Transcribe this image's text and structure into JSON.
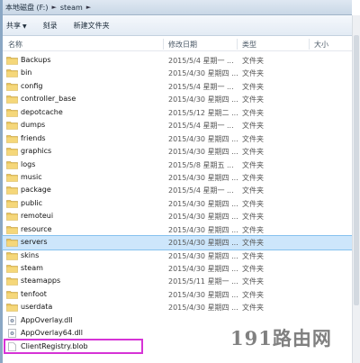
{
  "address": {
    "crumbs": [
      "本地磁盘 (F:)",
      "steam"
    ]
  },
  "toolbar": {
    "share_label": "共享",
    "burn_label": "刻录",
    "new_folder_label": "新建文件夹"
  },
  "columns": {
    "name": "名称",
    "date": "修改日期",
    "type": "类型",
    "size": "大小"
  },
  "rows": [
    {
      "name": "Backups",
      "date": "2015/5/4 星期一 ...",
      "type": "文件夹",
      "kind": "folder"
    },
    {
      "name": "bin",
      "date": "2015/4/30 星期四 ...",
      "type": "文件夹",
      "kind": "folder"
    },
    {
      "name": "config",
      "date": "2015/5/4 星期一 ...",
      "type": "文件夹",
      "kind": "folder"
    },
    {
      "name": "controller_base",
      "date": "2015/4/30 星期四 ...",
      "type": "文件夹",
      "kind": "folder"
    },
    {
      "name": "depotcache",
      "date": "2015/5/12 星期二 ...",
      "type": "文件夹",
      "kind": "folder"
    },
    {
      "name": "dumps",
      "date": "2015/5/4 星期一 ...",
      "type": "文件夹",
      "kind": "folder"
    },
    {
      "name": "friends",
      "date": "2015/4/30 星期四 ...",
      "type": "文件夹",
      "kind": "folder"
    },
    {
      "name": "graphics",
      "date": "2015/4/30 星期四 ...",
      "type": "文件夹",
      "kind": "folder"
    },
    {
      "name": "logs",
      "date": "2015/5/8 星期五 ...",
      "type": "文件夹",
      "kind": "folder"
    },
    {
      "name": "music",
      "date": "2015/4/30 星期四 ...",
      "type": "文件夹",
      "kind": "folder"
    },
    {
      "name": "package",
      "date": "2015/5/4 星期一 ...",
      "type": "文件夹",
      "kind": "folder"
    },
    {
      "name": "public",
      "date": "2015/4/30 星期四 ...",
      "type": "文件夹",
      "kind": "folder"
    },
    {
      "name": "remoteui",
      "date": "2015/4/30 星期四 ...",
      "type": "文件夹",
      "kind": "folder"
    },
    {
      "name": "resource",
      "date": "2015/4/30 星期四 ...",
      "type": "文件夹",
      "kind": "folder"
    },
    {
      "name": "servers",
      "date": "2015/4/30 星期四 ...",
      "type": "文件夹",
      "kind": "folder",
      "selected": true
    },
    {
      "name": "skins",
      "date": "2015/4/30 星期四 ...",
      "type": "文件夹",
      "kind": "folder"
    },
    {
      "name": "steam",
      "date": "2015/4/30 星期四 ...",
      "type": "文件夹",
      "kind": "folder"
    },
    {
      "name": "steamapps",
      "date": "2015/5/11 星期一 ...",
      "type": "文件夹",
      "kind": "folder"
    },
    {
      "name": "tenfoot",
      "date": "2015/4/30 星期四 ...",
      "type": "文件夹",
      "kind": "folder"
    },
    {
      "name": "userdata",
      "date": "2015/4/30 星期四 ...",
      "type": "文件夹",
      "kind": "folder"
    },
    {
      "name": "AppOverlay.dll",
      "date": "",
      "type": "",
      "kind": "dll"
    },
    {
      "name": "AppOverlay64.dll",
      "date": "",
      "type": "",
      "kind": "dll"
    },
    {
      "name": "ClientRegistry.blob",
      "date": "",
      "type": "",
      "kind": "file"
    }
  ],
  "watermark": "191路由网"
}
